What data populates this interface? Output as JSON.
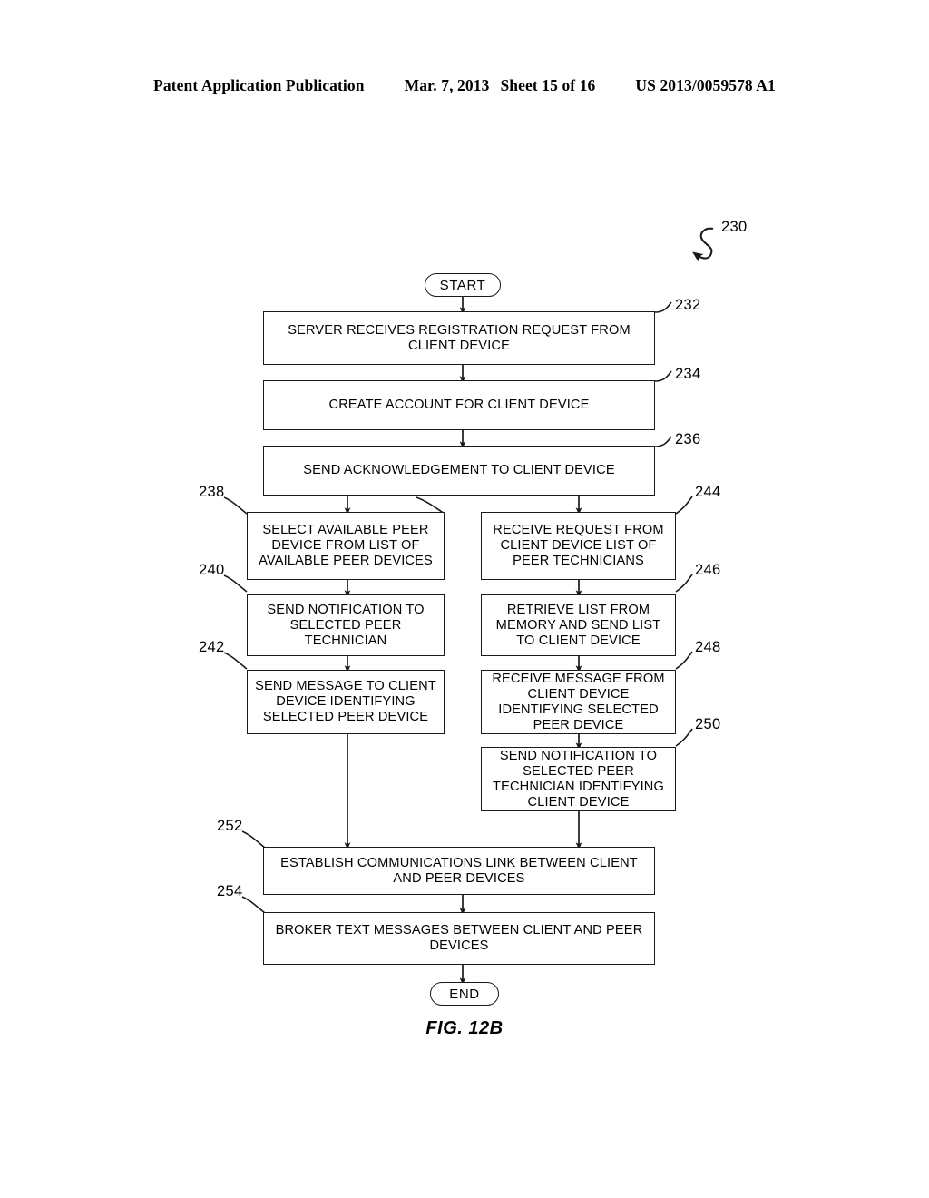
{
  "header": {
    "publication": "Patent Application Publication",
    "date": "Mar. 7, 2013",
    "sheet": "Sheet 15 of 16",
    "patent_number": "US 2013/0059578 A1"
  },
  "figure": {
    "caption": "FIG. 12B",
    "flowchart_ref": "230",
    "start_label": "START",
    "end_label": "END"
  },
  "nodes": {
    "n232": {
      "ref": "232",
      "text": "SERVER RECEIVES REGISTRATION REQUEST FROM CLIENT DEVICE"
    },
    "n234": {
      "ref": "234",
      "text": "CREATE ACCOUNT FOR CLIENT DEVICE"
    },
    "n236": {
      "ref": "236",
      "text": "SEND ACKNOWLEDGEMENT TO CLIENT DEVICE"
    },
    "n238": {
      "ref": "238",
      "text": "SELECT AVAILABLE PEER DEVICE FROM LIST OF AVAILABLE PEER DEVICES"
    },
    "n240": {
      "ref": "240",
      "text": "SEND NOTIFICATION TO SELECTED PEER TECHNICIAN"
    },
    "n242": {
      "ref": "242",
      "text": "SEND MESSAGE TO CLIENT DEVICE IDENTIFYING SELECTED PEER DEVICE"
    },
    "n244": {
      "ref": "244",
      "text": "RECEIVE REQUEST FROM CLIENT DEVICE LIST OF PEER TECHNICIANS"
    },
    "n246": {
      "ref": "246",
      "text": "RETRIEVE LIST FROM MEMORY AND SEND LIST TO CLIENT DEVICE"
    },
    "n248": {
      "ref": "248",
      "text": "RECEIVE MESSAGE FROM CLIENT DEVICE IDENTIFYING SELECTED PEER DEVICE"
    },
    "n250": {
      "ref": "250",
      "text": "SEND NOTIFICATION TO SELECTED PEER TECHNICIAN IDENTIFYING CLIENT DEVICE"
    },
    "n252": {
      "ref": "252",
      "text": "ESTABLISH COMMUNICATIONS LINK BETWEEN CLIENT AND PEER DEVICES"
    },
    "n254": {
      "ref": "254",
      "text": "BROKER TEXT MESSAGES BETWEEN CLIENT AND PEER DEVICES"
    }
  },
  "colors": {
    "ink": "#1a1a1a",
    "paper": "#ffffff"
  }
}
